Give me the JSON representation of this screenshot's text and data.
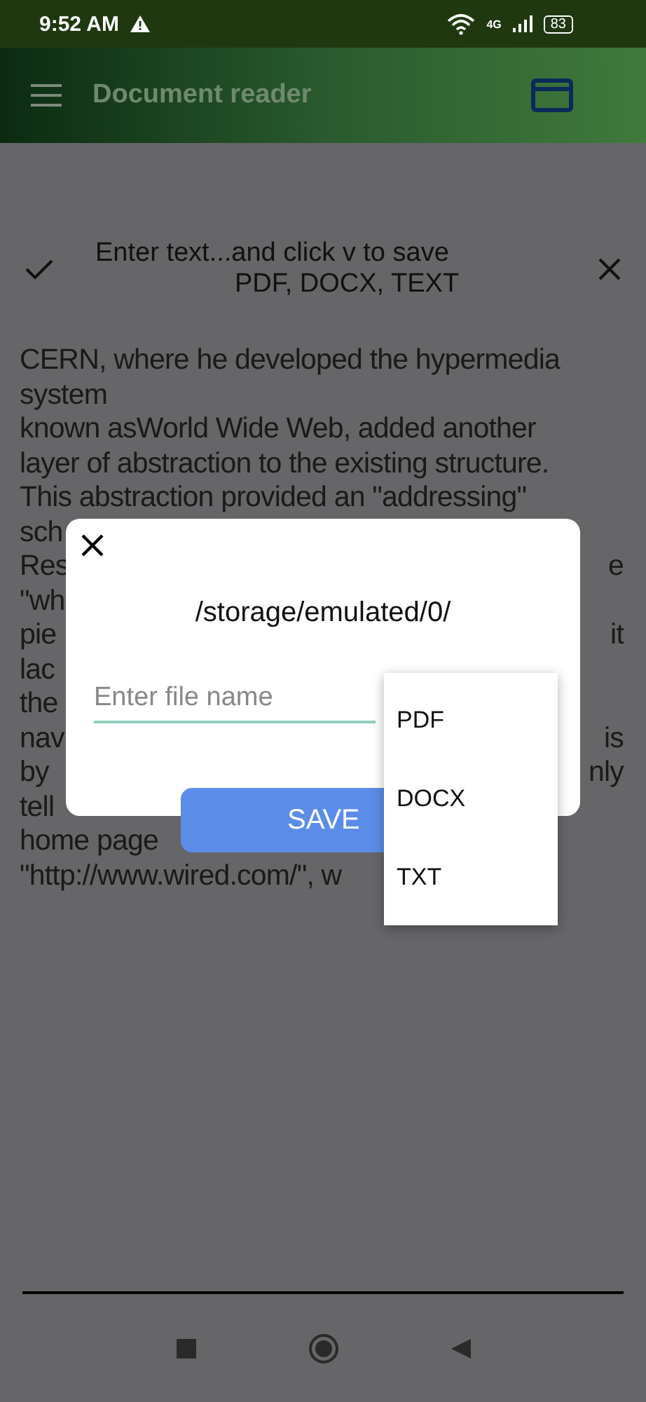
{
  "status_bar": {
    "time": "9:52 AM",
    "network": "4G",
    "battery": "83"
  },
  "app_bar": {
    "title": "Document reader"
  },
  "prompt": {
    "lines": [
      "Enter text...and click v to save",
      "PDF, DOCX, TEXT"
    ]
  },
  "document": {
    "lines": [
      {
        "left": "CERN, where he developed the hypermedia"
      },
      {
        "left": "system"
      },
      {
        "left": "known asWorld Wide Web, added another"
      },
      {
        "left": "layer of abstraction to the existing structure."
      },
      {
        "left": "This abstraction provided an \"addressing\""
      },
      {
        "left": "sch"
      },
      {
        "left": "Res",
        "right": "e"
      },
      {
        "left": "\"wh"
      },
      {
        "left": "pie",
        "right": "it"
      },
      {
        "left": "lac"
      },
      {
        "left": "the"
      },
      {
        "left": "nav",
        "right": "is"
      },
      {
        "left": "by",
        "right": "nly"
      },
      {
        "left": "tell"
      },
      {
        "left": "home page"
      },
      {
        "left": "\"http://www.wired.com/\", w"
      }
    ]
  },
  "dialog": {
    "path": "/storage/emulated/0/",
    "file_name": {
      "placeholder": "Enter file name"
    },
    "save_button": "SAVE"
  },
  "format_menu": {
    "items": [
      "PDF",
      "DOCX",
      "TXT"
    ]
  }
}
